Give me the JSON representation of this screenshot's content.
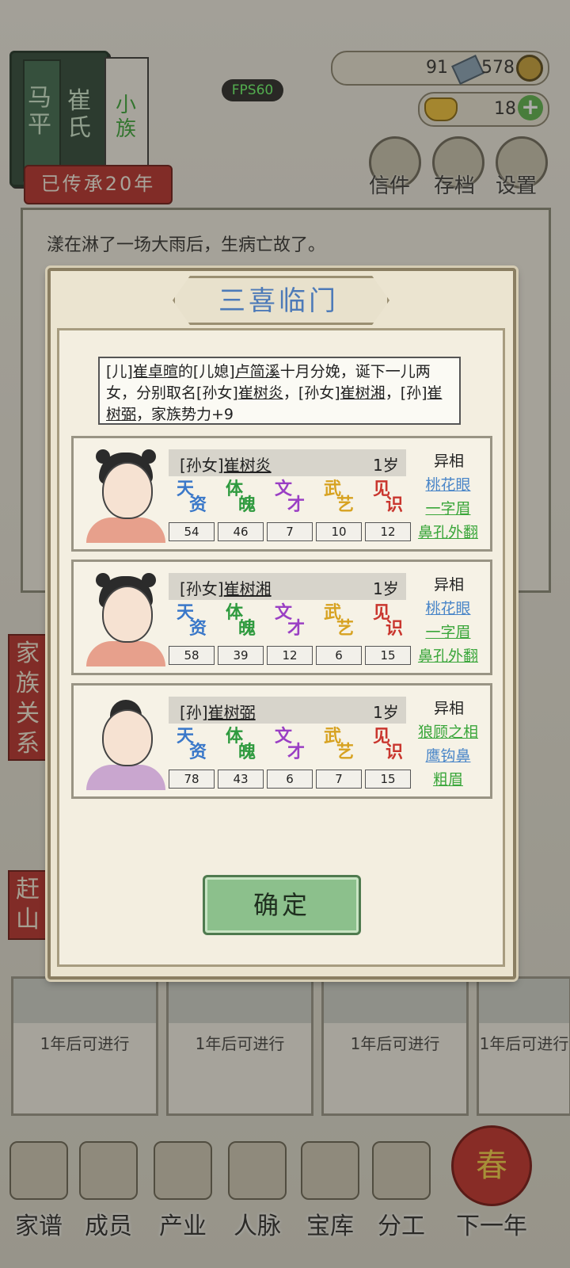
{
  "family": {
    "patriarch_chars": "马平",
    "clan_chars": "崔氏",
    "clan_tag": "小族",
    "inheritance": "已传承20年"
  },
  "fps": "FPS60",
  "resources": {
    "silver_count": "91",
    "coin_count": "578",
    "gold_count": "18"
  },
  "top_menu": {
    "letters": "信件",
    "save": "存档",
    "settings": "设置"
  },
  "log": {
    "line1": "漾在淋了一场大雨后，生病亡故了。"
  },
  "side_tags": {
    "family_relations": "家族关系",
    "rush": "赶山"
  },
  "cards": [
    {
      "text": "1年后可进行"
    },
    {
      "text": "1年后可进行"
    },
    {
      "text": "1年后可进行"
    },
    {
      "text": "1年后可进行"
    }
  ],
  "bottom_nav": {
    "genealogy": "家谱",
    "members": "成员",
    "industry": "产业",
    "network": "人脉",
    "treasury": "宝库",
    "division": "分工",
    "next_year": "下一年",
    "spring": "春"
  },
  "dialog": {
    "title": "三喜临门",
    "message_parts": {
      "p1": "[儿]",
      "n1": "崔卓暄",
      "p2": "的[儿媳]",
      "n2": "卢简溪",
      "p3": "十月分娩，诞下一儿两女，分别取名[孙女]",
      "n3": "崔树炎",
      "p4": "，[孙女]",
      "n4": "崔树湘",
      "p5": "，[孙]",
      "n5": "崔树弼",
      "p6": "，家族势力+9"
    },
    "stat_labels": {
      "talent": "天资",
      "physique": "体魄",
      "literary": "文才",
      "martial": "武艺",
      "insight": "见识"
    },
    "traits_label": "异相",
    "children": [
      {
        "relation": "[孙女]",
        "name": "崔树炎",
        "age": "1岁",
        "stats": {
          "talent": 54,
          "physique": 46,
          "literary": 7,
          "martial": 10,
          "insight": 12
        },
        "traits": [
          "桃花眼",
          "一字眉",
          "鼻孔外翻"
        ]
      },
      {
        "relation": "[孙女]",
        "name": "崔树湘",
        "age": "1岁",
        "stats": {
          "talent": 58,
          "physique": 39,
          "literary": 12,
          "martial": 6,
          "insight": 15
        },
        "traits": [
          "桃花眼",
          "一字眉",
          "鼻孔外翻"
        ]
      },
      {
        "relation": "[孙]",
        "name": "崔树弼",
        "age": "1岁",
        "stats": {
          "talent": 78,
          "physique": 43,
          "literary": 6,
          "martial": 7,
          "insight": 15
        },
        "traits": [
          "狼顾之相",
          "鹰钩鼻",
          "粗眉"
        ]
      }
    ],
    "confirm": "确定"
  },
  "colors": {
    "title_blue": "#4d7ab8",
    "talent": "#3a78c9",
    "physique": "#2e9a3e",
    "literary": "#9a3fc4",
    "martial": "#d7a220",
    "insight": "#c9362e",
    "trait_blue": "#4a86c8",
    "trait_green": "#3aa63a"
  }
}
